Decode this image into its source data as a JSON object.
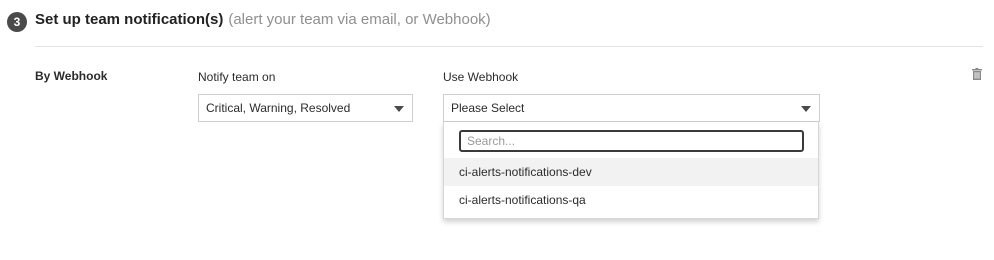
{
  "step": {
    "number": "3",
    "title": "Set up team notification(s)",
    "subtitle": "(alert your team via email, or Webhook)"
  },
  "row": {
    "label": "By Webhook",
    "notify": {
      "label": "Notify team on",
      "value": "Critical, Warning, Resolved"
    },
    "webhook": {
      "label": "Use Webhook",
      "value": "Please Select",
      "search_placeholder": "Search...",
      "search_value": "",
      "options": [
        "ci-alerts-notifications-dev",
        "ci-alerts-notifications-qa"
      ]
    },
    "delete_icon": "trash-icon"
  },
  "colors": {
    "badge": "#4a4a4a",
    "subtitle": "#8f8f8f",
    "highlight": "#f2f2f2",
    "border": "#cfcfcf"
  }
}
